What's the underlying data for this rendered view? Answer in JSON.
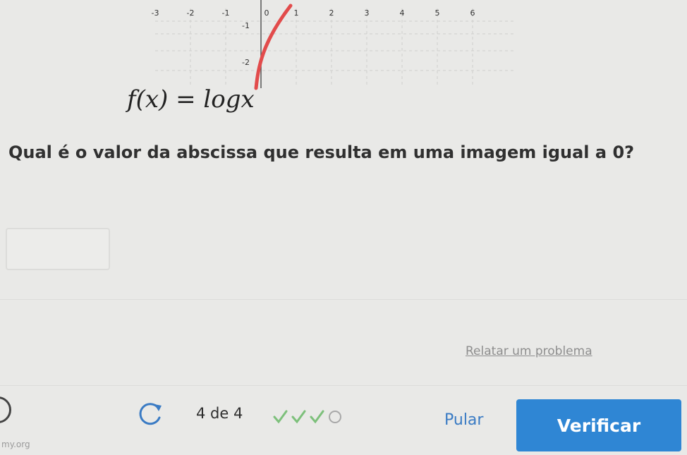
{
  "graph": {
    "x_ticks": [
      "-3",
      "-2",
      "-1",
      "0",
      "1",
      "2",
      "3",
      "4",
      "5",
      "6"
    ],
    "y_ticks": [
      "-1",
      "-2"
    ],
    "curve_color": "#e24b4b",
    "formula": "f(x) = logx"
  },
  "question": {
    "text": "Qual é o valor da abscissa que resulta em uma imagem igual a 0?"
  },
  "answer": {
    "value": "",
    "placeholder": ""
  },
  "report_link": "Relatar um problema",
  "footer": {
    "site": "my.org",
    "progress_text": "4 de 4",
    "progress_marks": [
      "check",
      "check",
      "check",
      "empty"
    ],
    "skip_label": "Pular",
    "verify_label": "Verificar",
    "accent_color": "#2f86d4"
  }
}
